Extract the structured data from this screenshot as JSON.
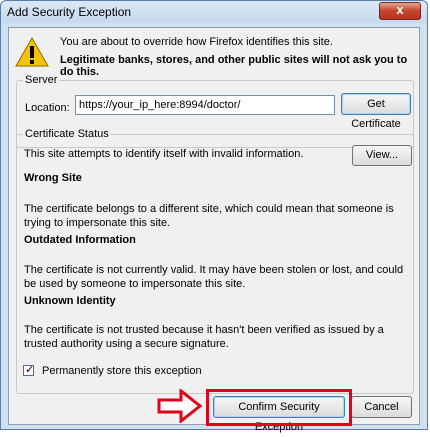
{
  "window": {
    "title": "Add Security Exception",
    "close_glyph": "x"
  },
  "message": {
    "line1": "You are about to override how Firefox identifies this site.",
    "line2": "Legitimate banks, stores, and other public sites will not ask you to do this."
  },
  "server": {
    "legend": "Server",
    "location_label": "Location:",
    "location_value": "https://your_ip_here:8994/doctor/",
    "get_certificate_label": "Get Certificate"
  },
  "status": {
    "legend": "Certificate Status",
    "intro": "This site attempts to identify itself with invalid information.",
    "view_label": "View...",
    "sections": [
      {
        "heading": "Wrong Site",
        "body": "The certificate belongs to a different site, which could mean that someone is trying to impersonate this site."
      },
      {
        "heading": "Outdated Information",
        "body": "The certificate is not currently valid. It may have been stolen or lost, and could be used by someone to impersonate this site."
      },
      {
        "heading": "Unknown Identity",
        "body": "The certificate is not trusted because it hasn't been verified as issued by a trusted authority using a secure signature."
      }
    ]
  },
  "permanent": {
    "label": "Permanently store this exception",
    "checked": true,
    "check_glyph": "✓"
  },
  "buttons": {
    "confirm_label": "Confirm Security Exception",
    "cancel_label": "Cancel"
  },
  "colors": {
    "highlight": "#e2001a",
    "warning": "#f5c400"
  }
}
